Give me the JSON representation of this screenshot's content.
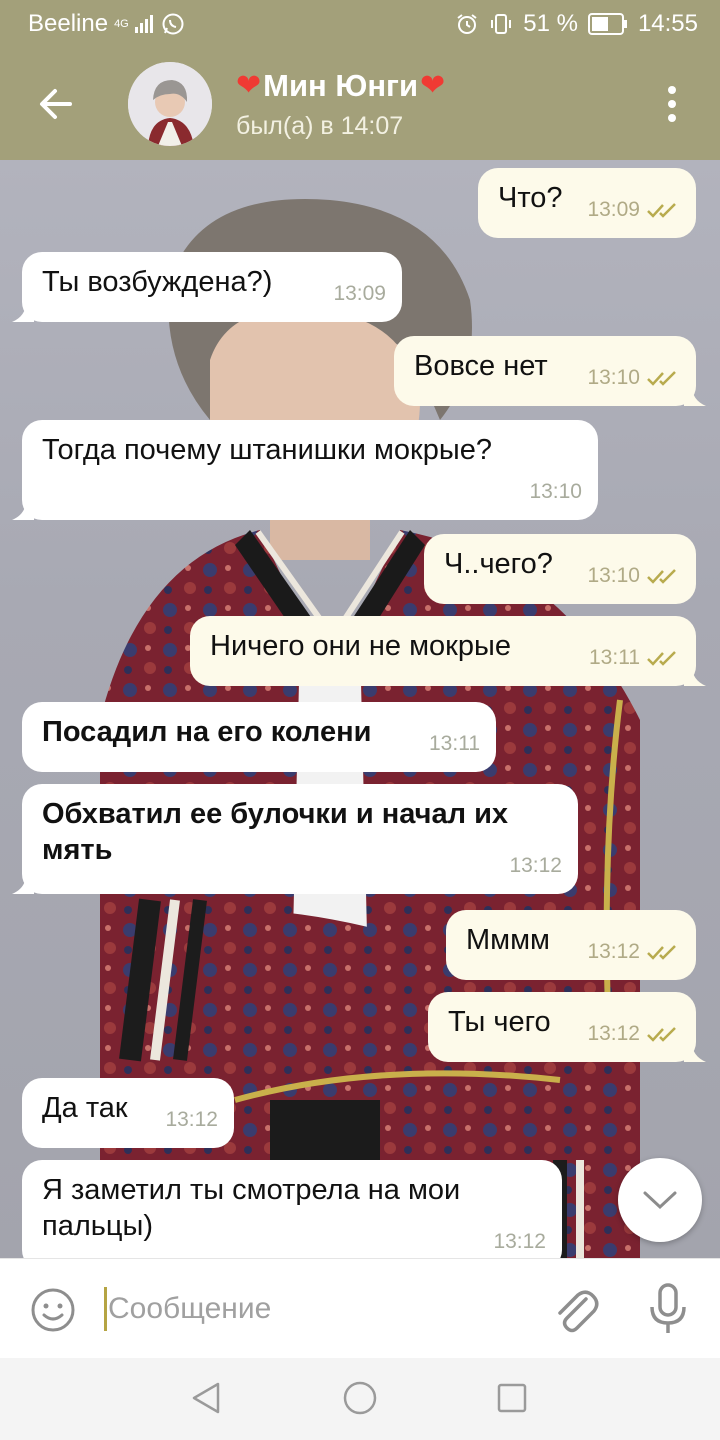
{
  "status_bar": {
    "carrier": "Beeline",
    "network": "4G",
    "battery": "51 %",
    "time": "14:55"
  },
  "header": {
    "name": "Мин Юнги",
    "last_seen": "был(а) в 14:07"
  },
  "messages": [
    {
      "dir": "out",
      "text": "Что?",
      "time": "13:09",
      "bold": false
    },
    {
      "dir": "in",
      "text": "Ты возбуждена?)",
      "time": "13:09",
      "bold": false
    },
    {
      "dir": "out",
      "text": "Вовсе нет",
      "time": "13:10",
      "bold": false
    },
    {
      "dir": "in",
      "text": "Тогда почему штанишки мокрые?",
      "time": "13:10",
      "bold": false
    },
    {
      "dir": "out",
      "text": "Ч..чего?",
      "time": "13:10",
      "bold": false
    },
    {
      "dir": "out",
      "text": "Ничего они не мокрые",
      "time": "13:11",
      "bold": false
    },
    {
      "dir": "in",
      "text": "Посадил на его колени",
      "time": "13:11",
      "bold": true
    },
    {
      "dir": "in",
      "text": "Обхватил ее булочки и начал их мять",
      "time": "13:12",
      "bold": true
    },
    {
      "dir": "out",
      "text": "Мммм",
      "time": "13:12",
      "bold": false
    },
    {
      "dir": "out",
      "text": "Ты чего",
      "time": "13:12",
      "bold": false
    },
    {
      "dir": "in",
      "text": "Да так",
      "time": "13:12",
      "bold": false
    },
    {
      "dir": "in",
      "text": "Я заметил ты смотрела на мои пальцы)",
      "time": "13:12",
      "bold": false
    }
  ],
  "input": {
    "placeholder": "Сообщение",
    "value": ""
  },
  "colors": {
    "header": "#a3a07a",
    "outgoing_bubble": "#fdfaea",
    "incoming_bubble": "#ffffff",
    "read_tick": "#b8ab4e",
    "heart": "#f03a33"
  },
  "icons": {
    "back": "arrow-left-icon",
    "menu": "more-vertical-icon",
    "emoji": "smile-icon",
    "attach": "paperclip-icon",
    "mic": "microphone-icon",
    "scroll": "chevron-down-icon"
  }
}
